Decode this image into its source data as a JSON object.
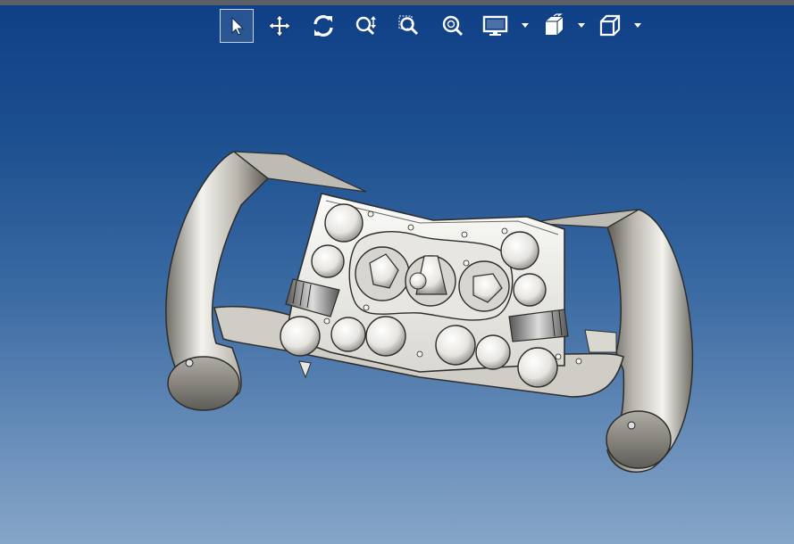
{
  "toolbar": {
    "items": [
      {
        "name": "select-tool",
        "icon": "cursor-arrow-icon",
        "active": true
      },
      {
        "name": "pan-tool",
        "icon": "move-arrows-icon",
        "active": false
      },
      {
        "name": "rotate-tool",
        "icon": "rotate-icon",
        "active": false
      },
      {
        "name": "zoom-tool",
        "icon": "zoom-updown-icon",
        "active": false
      },
      {
        "name": "zoom-window-tool",
        "icon": "zoom-window-icon",
        "active": false
      },
      {
        "name": "zoom-fit-tool",
        "icon": "zoom-fit-icon",
        "active": false
      },
      {
        "name": "display-mode-menu",
        "icon": "monitor-icon",
        "dropdown": true
      },
      {
        "name": "section-view-menu",
        "icon": "section-view-icon",
        "dropdown": true
      },
      {
        "name": "view-orientation-menu",
        "icon": "cube-view-icon",
        "dropdown": true
      }
    ]
  },
  "viewport": {
    "model": "steering-wheel-assembly",
    "background_top": "#0f3f86",
    "background_bottom": "#86a6c7"
  }
}
